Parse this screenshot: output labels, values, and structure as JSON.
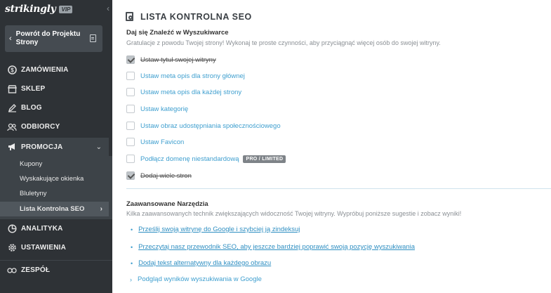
{
  "sidebar": {
    "brand": "strikingly",
    "badge": "VIP",
    "back_button": "Powrót do Projektu Strony",
    "nav": [
      {
        "id": "orders",
        "label": "ZAMÓWIENIA",
        "icon": "dollar-circle-icon"
      },
      {
        "id": "store",
        "label": "SKLEP",
        "icon": "store-icon"
      },
      {
        "id": "blog",
        "label": "BLOG",
        "icon": "pen-icon"
      },
      {
        "id": "audience",
        "label": "ODBIORCY",
        "icon": "people-icon"
      },
      {
        "id": "promotion",
        "label": "PROMOCJA",
        "icon": "megaphone-icon"
      },
      {
        "id": "analytics",
        "label": "ANALITYKA",
        "icon": "chart-pie-icon"
      },
      {
        "id": "settings",
        "label": "USTAWIENIA",
        "icon": "gear-icon"
      },
      {
        "id": "team",
        "label": "ZESPÓŁ",
        "icon": "team-icon"
      }
    ],
    "promotion_sub": [
      {
        "label": "Kupony"
      },
      {
        "label": "Wyskakujące okienka"
      },
      {
        "label": "Bluletyny"
      },
      {
        "label": "Lista Kontrolna SEO"
      }
    ]
  },
  "main": {
    "title": "LISTA KONTROLNA SEO",
    "section1": {
      "heading": "Daj się Znaleźć w Wyszukiwarce",
      "desc": "Gratulacje z powodu Twojej strony! Wykonaj te proste czynności, aby przyciągnąć więcej osób do swojej witryny.",
      "items": [
        {
          "label": "Ustaw tytuł swojej witryny",
          "checked": true
        },
        {
          "label": "Ustaw meta opis dla strony głównej",
          "checked": false
        },
        {
          "label": "Ustaw meta opis dla każdej strony",
          "checked": false
        },
        {
          "label": "Ustaw kategorię",
          "checked": false
        },
        {
          "label": "Ustaw obraz udostępniania społecznościowego",
          "checked": false
        },
        {
          "label": "Ustaw Favicon",
          "checked": false
        },
        {
          "label": "Podłącz domenę niestandardową",
          "checked": false,
          "badge": "PRO / LIMITED"
        },
        {
          "label": "Dodaj wiele stron",
          "checked": true
        }
      ]
    },
    "section2": {
      "heading": "Zaawansowane Narzędzia",
      "desc": "Kilka zaawansowanych technik zwiększających widoczność Twojej witryny. Wypróbuj poniższe sugestie i zobacz wyniki!",
      "links": [
        {
          "label": "Prześlij swoją witrynę do Google i szybciej ją zindeksuj"
        },
        {
          "label": "Przeczytaj nasz przewodnik SEO, aby jeszcze bardziej poprawić swoją pozycję wyszukiwania"
        },
        {
          "label": "Dodaj tekst alternatywny dla każdego obrazu"
        },
        {
          "label": "Podgląd wyników wyszukiwania w Google"
        }
      ]
    }
  }
}
